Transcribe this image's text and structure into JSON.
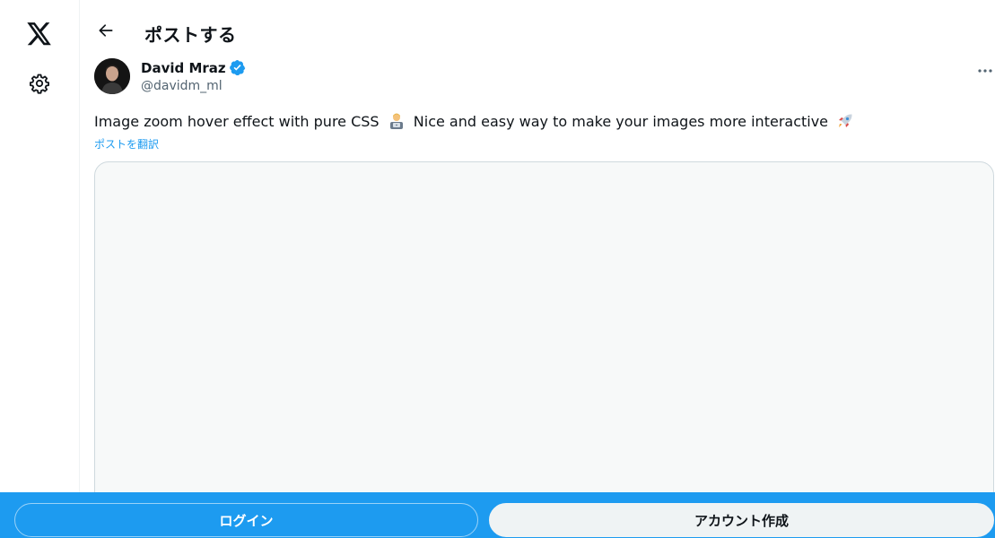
{
  "header": {
    "title": "ポストする"
  },
  "post": {
    "author": {
      "display_name": "David Mraz",
      "handle": "@davidm_ml",
      "verified": true
    },
    "text_before_emoji1": "Image zoom hover effect with pure CSS",
    "emoji1": "man-technologist-emoji",
    "text_after_emoji1": "Nice and easy way to make your images more interactive",
    "emoji2": "rocket-emoji",
    "translate_label": "ポストを翻訳"
  },
  "bottom_bar": {
    "login_label": "ログイン",
    "signup_label": "アカウント作成"
  },
  "colors": {
    "accent": "#1d9bf0",
    "text": "#0f1419",
    "muted": "#536471",
    "media_bg": "#f7f9f9"
  },
  "icons": {
    "logo": "x-logo-icon",
    "settings": "gear-icon",
    "back": "arrow-left-icon",
    "more": "more-horizontal-icon",
    "verified": "verified-badge-icon"
  }
}
